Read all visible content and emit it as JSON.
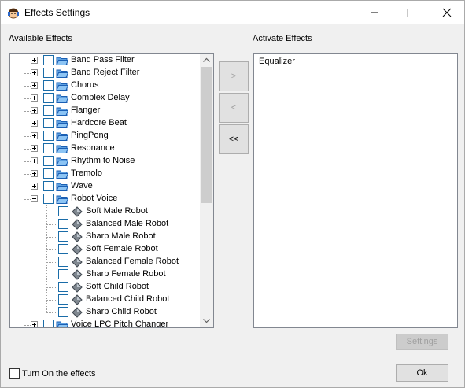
{
  "window": {
    "title": "Effects Settings"
  },
  "available": {
    "label": "Available Effects",
    "folders": [
      "Band Pass Filter",
      "Band Reject Filter",
      "Chorus",
      "Complex Delay",
      "Flanger",
      "Hardcore Beat",
      "PingPong",
      "Resonance",
      "Rhythm to Noise",
      "Tremolo",
      "Wave"
    ],
    "expanded_folder": "Robot Voice",
    "robot_children": [
      "Soft Male Robot",
      "Balanced Male Robot",
      "Sharp Male Robot",
      "Soft Female Robot",
      "Balanced Female Robot",
      "Sharp Female Robot",
      "Soft Child Robot",
      "Balanced Child Robot",
      "Sharp Child Robot"
    ],
    "last_folder": "Voice LPC Pitch Changer"
  },
  "active": {
    "label": "Activate Effects",
    "items": [
      "Equalizer"
    ]
  },
  "buttons": {
    "add": ">",
    "remove": "<",
    "remove_all": "<<",
    "settings": "Settings",
    "ok": "Ok"
  },
  "turn_on": {
    "label": "Turn On the effects",
    "checked": false
  }
}
